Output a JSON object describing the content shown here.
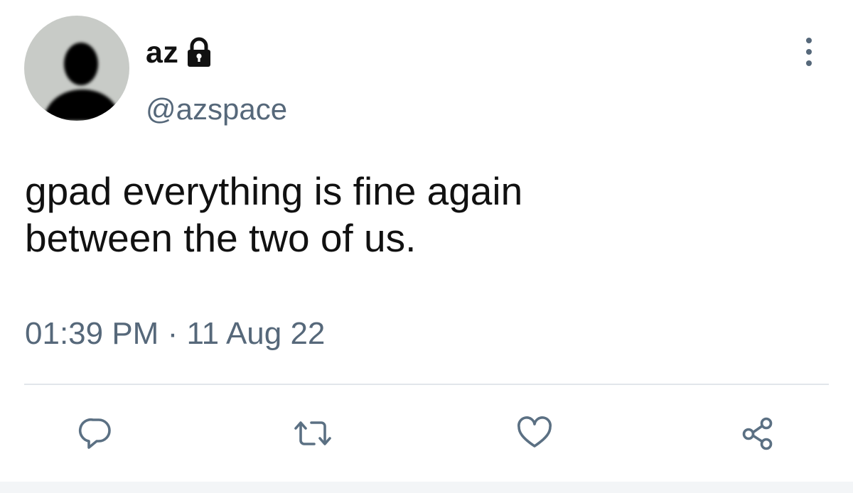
{
  "tweet": {
    "display_name": "az",
    "handle": "@azspace",
    "text": "gpad everything is fine again\nbetween the two of us.",
    "time": "01:39 PM",
    "separator": "·",
    "date": "11 Aug 22"
  },
  "icons": {
    "avatar": "default-avatar-icon",
    "protected": "lock-icon",
    "more": "more-vertical-icon",
    "reply": "reply-icon",
    "retweet": "retweet-icon",
    "like": "heart-icon",
    "share": "share-icon"
  },
  "colors": {
    "text": "#111111",
    "secondary": "#56687a",
    "icon": "#5b7083",
    "divider": "#e2e6ea",
    "avatar_bg": "#c8cbc7"
  }
}
